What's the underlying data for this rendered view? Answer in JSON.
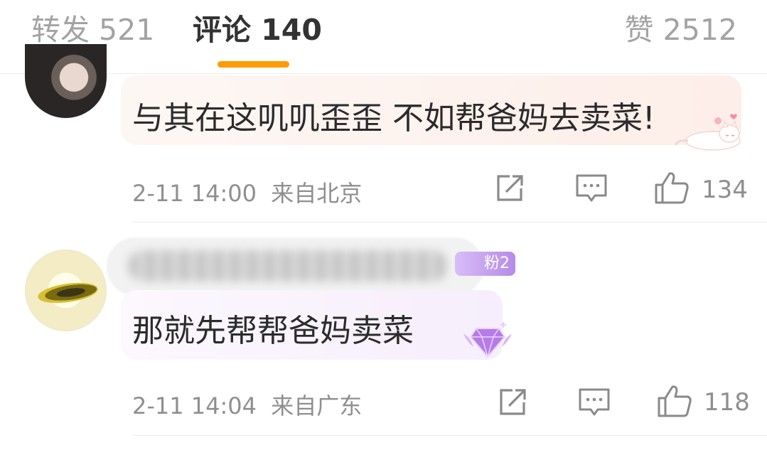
{
  "tabs": {
    "repost": {
      "label": "转发",
      "count": "521"
    },
    "comments": {
      "label": "评论",
      "count": "140"
    },
    "likes": {
      "label": "赞",
      "count": "2512"
    },
    "active_color": "#ff9a00"
  },
  "comments": [
    {
      "text": "与其在这叽叽歪歪 不如帮爸妈去卖菜!",
      "time": "2-11 14:00",
      "location": "来自北京",
      "likes": "134",
      "sticker": "cat-sticker"
    },
    {
      "author_badge": "粉2",
      "text": "那就先帮帮爸妈卖菜",
      "time": "2-11 14:04",
      "location": "来自广东",
      "likes": "118",
      "sticker": "gem-badge"
    }
  ],
  "icons": [
    "share-icon",
    "comment-icon",
    "thumbs-up-icon"
  ]
}
